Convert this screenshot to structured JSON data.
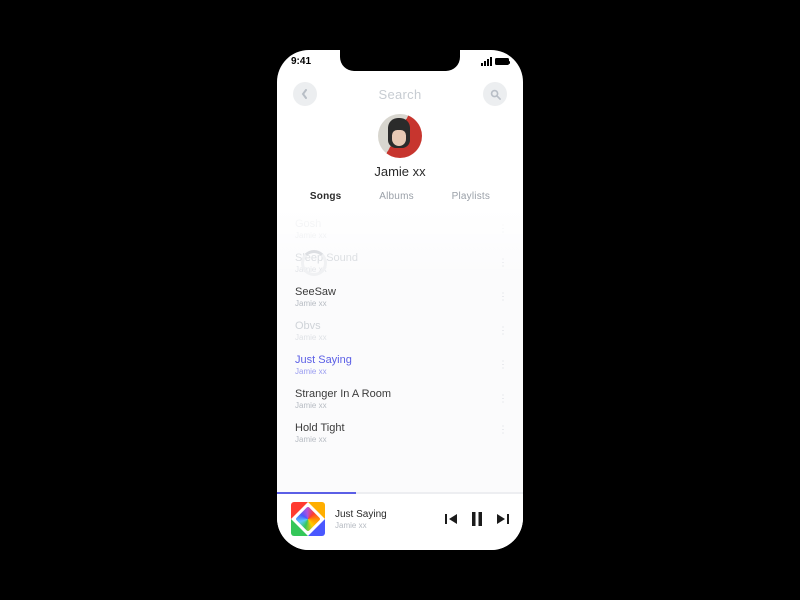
{
  "status": {
    "time": "9:41"
  },
  "header": {
    "title": "Search"
  },
  "artist": {
    "name": "Jamie xx"
  },
  "tabs": [
    {
      "label": "Songs",
      "active": true
    },
    {
      "label": "Albums",
      "active": false
    },
    {
      "label": "Playlists",
      "active": false
    }
  ],
  "songs": [
    {
      "title": "Gosh",
      "artist": "Jamie xx",
      "dim": true
    },
    {
      "title": "Sleep Sound",
      "artist": "Jamie xx",
      "dim": true
    },
    {
      "title": "SeeSaw",
      "artist": "Jamie xx"
    },
    {
      "title": "Obvs",
      "artist": "Jamie xx",
      "dim": true
    },
    {
      "title": "Just Saying",
      "artist": "Jamie xx",
      "active": true
    },
    {
      "title": "Stranger In A Room",
      "artist": "Jamie xx"
    },
    {
      "title": "Hold Tight",
      "artist": "Jamie xx",
      "cut": true
    }
  ],
  "player": {
    "title": "Just Saying",
    "artist": "Jamie xx",
    "progress_pct": 32
  }
}
